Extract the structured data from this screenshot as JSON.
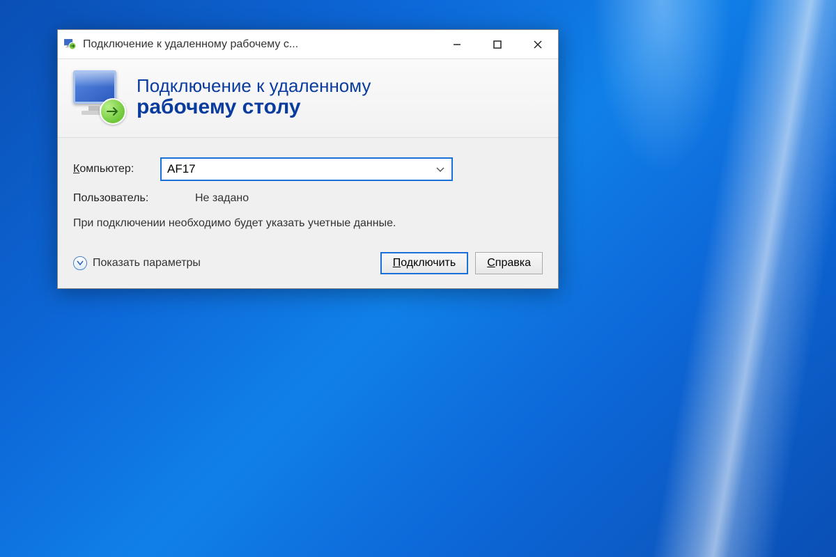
{
  "window": {
    "title": "Подключение к удаленному рабочему с..."
  },
  "header": {
    "line1": "Подключение к удаленному",
    "line2": "рабочему столу"
  },
  "form": {
    "computer_label_prefix": "К",
    "computer_label_rest": "омпьютер:",
    "computer_value": "AF17",
    "user_label": "Пользователь:",
    "user_value": "Не задано",
    "info_text": "При подключении необходимо будет указать учетные данные."
  },
  "footer": {
    "show_options_prefix": "П",
    "show_options_rest": "оказать параметры",
    "connect_prefix": "П",
    "connect_rest": "одключить",
    "help_prefix": "С",
    "help_rest": "правка"
  }
}
